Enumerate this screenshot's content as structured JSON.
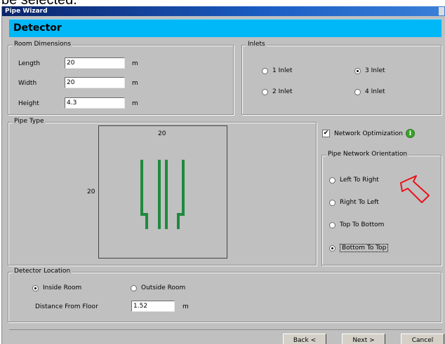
{
  "caption_fragment": "be selected.",
  "window": {
    "title": "Pipe Wizard"
  },
  "header": {
    "title": "Detector"
  },
  "room_dimensions": {
    "legend": "Room Dimensions",
    "length_label": "Length",
    "length_value": "20",
    "width_label": "Width",
    "width_value": "20",
    "height_label": "Height",
    "height_value": "4.3",
    "unit": "m"
  },
  "inlets": {
    "legend": "Inlets",
    "options": [
      "1 Inlet",
      "2 Inlet",
      "3 Inlet",
      "4 Inlet"
    ],
    "selected": "3 Inlet"
  },
  "pipe_type": {
    "legend": "Pipe Type",
    "width_label": "20",
    "height_label": "20",
    "pipe_color": "#1e8a3e"
  },
  "network_optimization": {
    "label": "Network Optimization",
    "checked": true,
    "check_glyph": "✔",
    "info_glyph": "i"
  },
  "orientation": {
    "legend": "Pipe Network Orientation",
    "options": [
      "Left To Right",
      "Right To Left",
      "Top To Bottom",
      "Bottom To Top"
    ],
    "selected": "Bottom To Top"
  },
  "annotation_arrow_color": "#e8141b",
  "detector_location": {
    "legend": "Detector Location",
    "inside_label": "Inside Room",
    "outside_label": "Outside Room",
    "selected": "Inside Room",
    "distance_label": "Distance From Floor",
    "distance_value": "1.52",
    "unit": "m"
  },
  "buttons": {
    "back": "Back <",
    "next": "Next >",
    "cancel": "Cancel"
  }
}
